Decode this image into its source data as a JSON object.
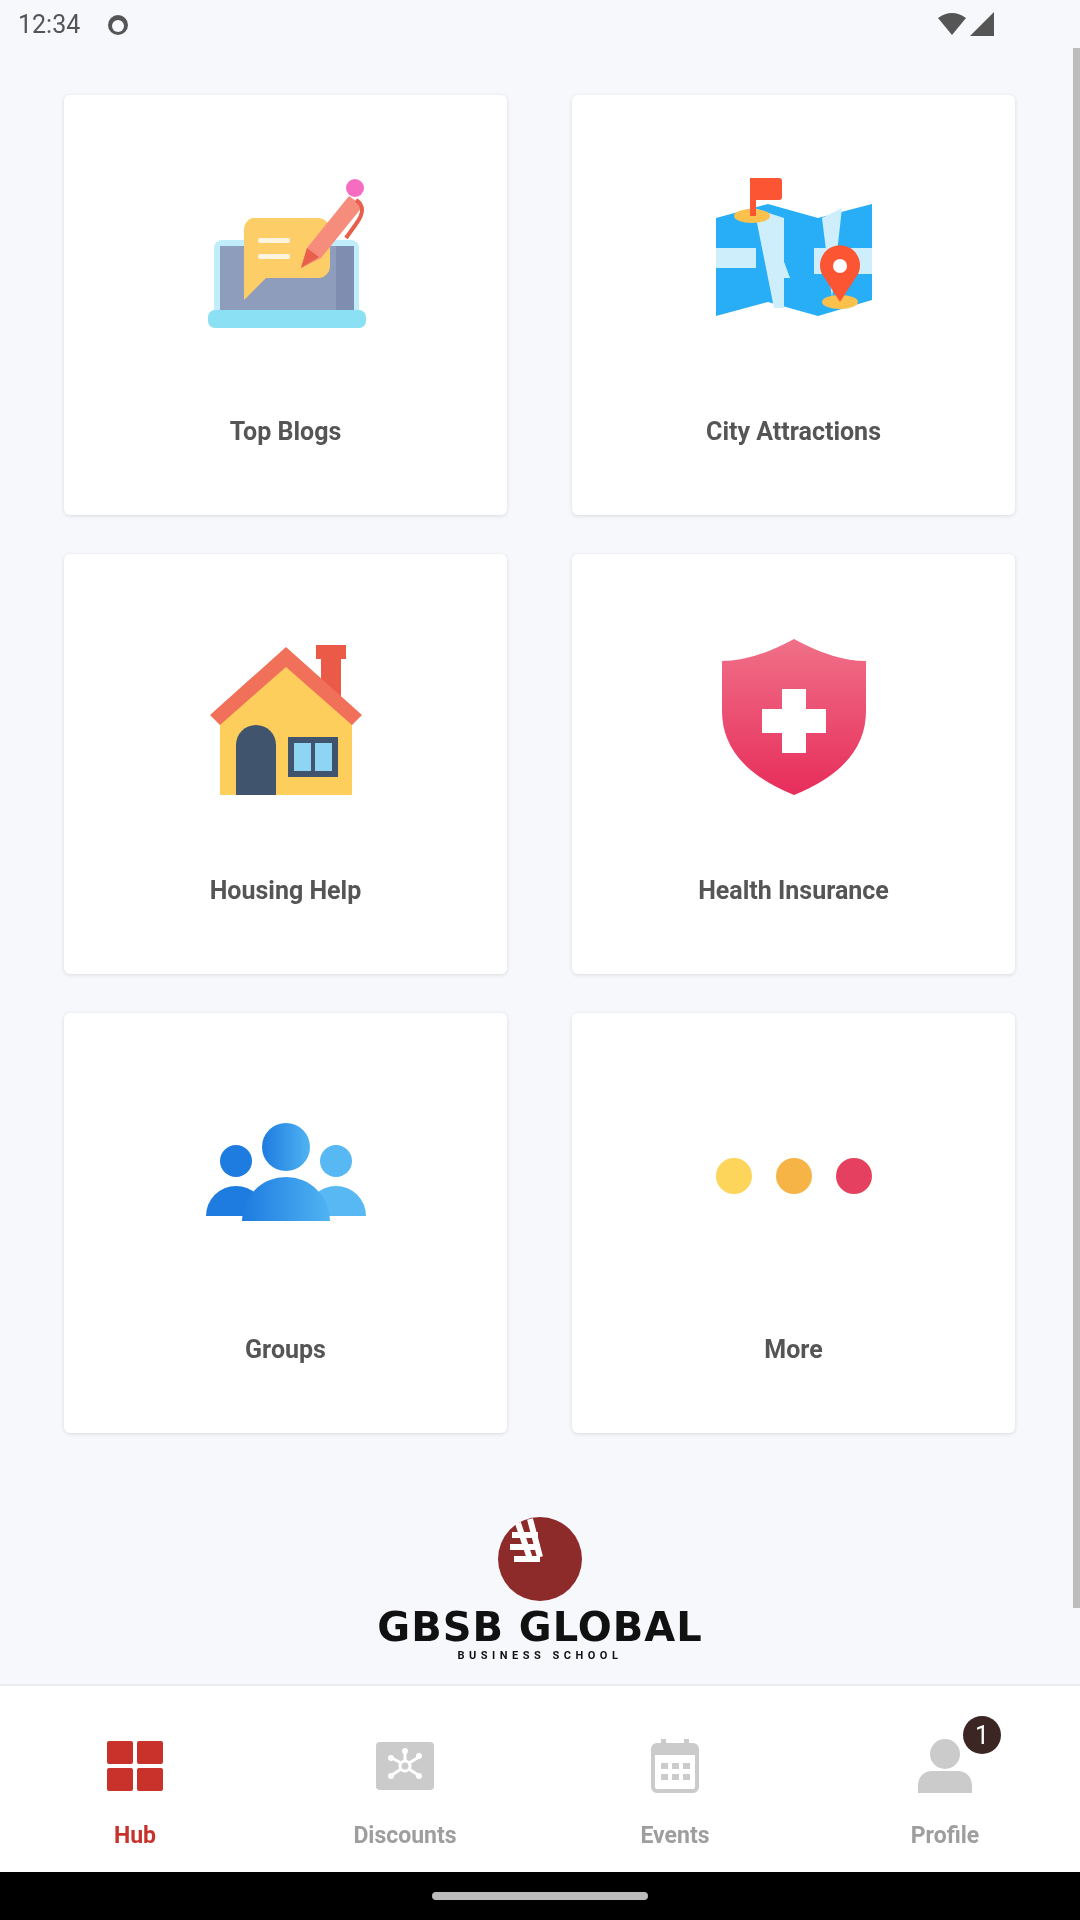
{
  "status_bar": {
    "time": "12:34"
  },
  "tiles": [
    {
      "label": "Top Blogs",
      "kind": "blog"
    },
    {
      "label": "City Attractions",
      "kind": "map"
    },
    {
      "label": "Housing Help",
      "kind": "house"
    },
    {
      "label": "Health Insurance",
      "kind": "shield"
    },
    {
      "label": "Groups",
      "kind": "people"
    },
    {
      "label": "More",
      "kind": "dots"
    }
  ],
  "logo": {
    "name": "GBSB GLOBAL",
    "subtitle": "BUSINESS SCHOOL"
  },
  "nav": [
    {
      "label": "Hub",
      "kind": "grid",
      "selected": true
    },
    {
      "label": "Discounts",
      "kind": "discount",
      "selected": false
    },
    {
      "label": "Events",
      "kind": "calendar",
      "selected": false
    },
    {
      "label": "Profile",
      "kind": "person",
      "selected": false,
      "badge": "1"
    }
  ]
}
